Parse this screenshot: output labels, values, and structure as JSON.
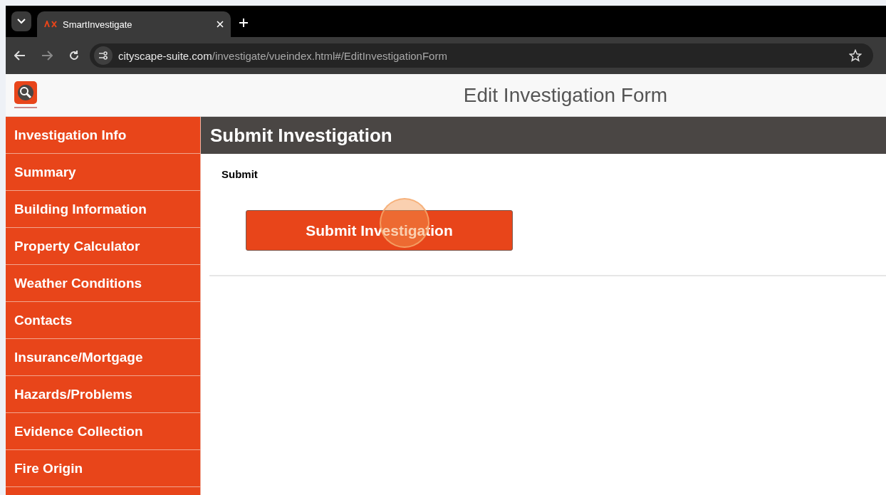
{
  "browser": {
    "tab_title": "SmartInvestigate",
    "url_host": "cityscape-suite.com",
    "url_path": "/investigate/vueindex.html#/EditInvestigationForm"
  },
  "header": {
    "title": "Edit Investigation Form"
  },
  "sidebar": {
    "items": [
      {
        "label": "Investigation Info"
      },
      {
        "label": "Summary"
      },
      {
        "label": "Building Information"
      },
      {
        "label": "Property Calculator"
      },
      {
        "label": "Weather Conditions"
      },
      {
        "label": "Contacts"
      },
      {
        "label": "Insurance/Mortgage"
      },
      {
        "label": "Hazards/Problems"
      },
      {
        "label": "Evidence Collection"
      },
      {
        "label": "Fire Origin"
      }
    ]
  },
  "section": {
    "title": "Submit Investigation",
    "label": "Submit",
    "button": "Submit Investigation"
  }
}
